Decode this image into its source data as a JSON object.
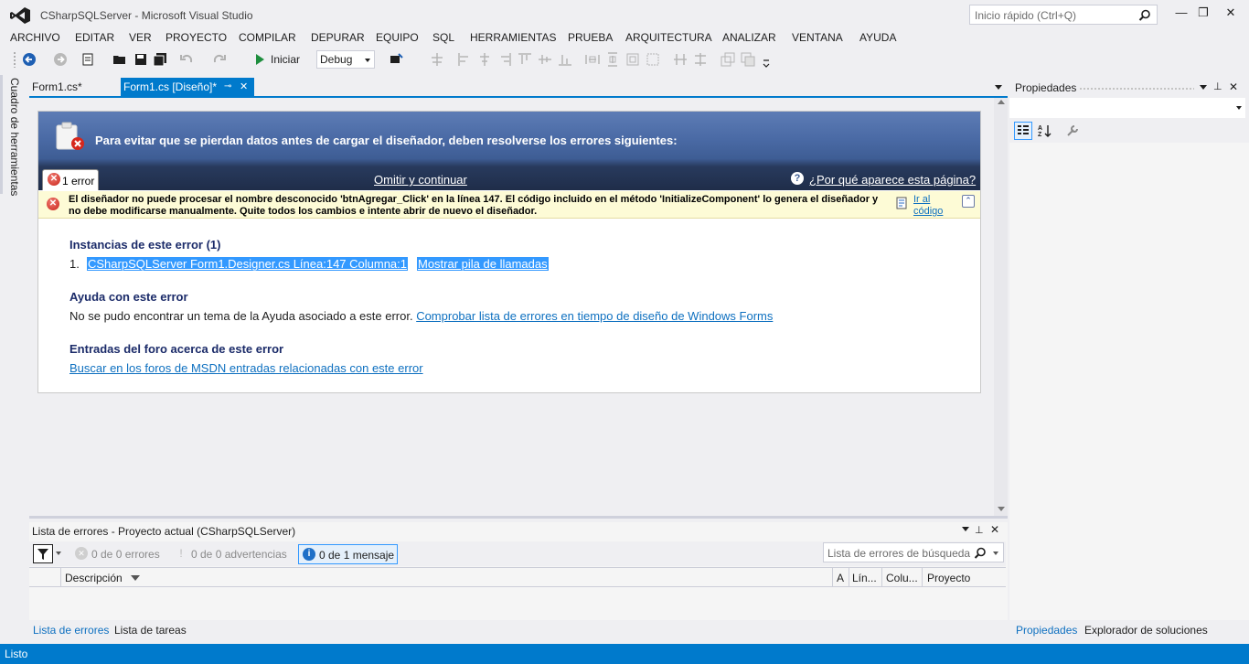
{
  "window": {
    "title": "CSharpSQLServer - Microsoft Visual Studio",
    "quick_launch_placeholder": "Inicio rápido (Ctrl+Q)"
  },
  "menu": [
    "ARCHIVO",
    "EDITAR",
    "VER",
    "PROYECTO",
    "COMPILAR",
    "DEPURAR",
    "EQUIPO",
    "SQL",
    "HERRAMIENTAS",
    "PRUEBA",
    "ARQUITECTURA",
    "ANALIZAR",
    "VENTANA",
    "AYUDA"
  ],
  "toolbar": {
    "start_label": "Iniciar",
    "config_value": "Debug"
  },
  "left_toolbox_label": "Cuadro de herramientas",
  "tabs": [
    {
      "label": "Form1.cs*",
      "active": false
    },
    {
      "label": "Form1.cs [Diseño]*",
      "active": true
    }
  ],
  "designer_error": {
    "banner_title": "Para evitar que se pierdan datos antes de cargar el diseñador, deben resolverse los errores siguientes:",
    "error_count_tab": "1 error",
    "omit_link": "Omitir y continuar",
    "why_link": "¿Por qué aparece esta página?",
    "message": "El diseñador no puede procesar el nombre desconocido 'btnAgregar_Click' en la línea 147. El código incluido en el método 'InitializeComponent' lo genera el diseñador y no debe modificarse manualmente. Quite todos los cambios e intente abrir de nuevo el diseñador.",
    "goto_code": "Ir al código",
    "instances_heading": "Instancias de este error (1)",
    "instance_number": "1.",
    "instance_link": "CSharpSQLServer Form1.Designer.cs Línea:147 Columna:1",
    "call_stack_link": "Mostrar pila de llamadas",
    "help_heading": "Ayuda con este error",
    "help_text": "No se pudo encontrar un tema de la Ayuda asociado a este error.",
    "help_link": "Comprobar lista de errores en tiempo de diseño de Windows Forms",
    "forum_heading": "Entradas del foro acerca de este error",
    "forum_link": "Buscar en los foros de MSDN entradas relacionadas con este error"
  },
  "error_list": {
    "title": "Lista de errores - Proyecto actual (CSharpSQLServer)",
    "errors_btn": "0 de 0 errores",
    "warnings_btn": "0 de 0 advertencias",
    "messages_btn": "0 de 1 mensaje",
    "search_placeholder": "Lista de errores de búsqueda",
    "columns": [
      "Descripción",
      "A",
      "Lín...",
      "Colu...",
      "Proyecto"
    ]
  },
  "bottom_tabs": [
    "Lista de errores",
    "Lista de tareas"
  ],
  "properties": {
    "title": "Propiedades"
  },
  "right_bottom_tabs": [
    "Propiedades",
    "Explorador de soluciones"
  ],
  "status": "Listo",
  "colors": {
    "accent": "#007acc",
    "link": "#0e70c0",
    "heading": "#1b2b69"
  }
}
